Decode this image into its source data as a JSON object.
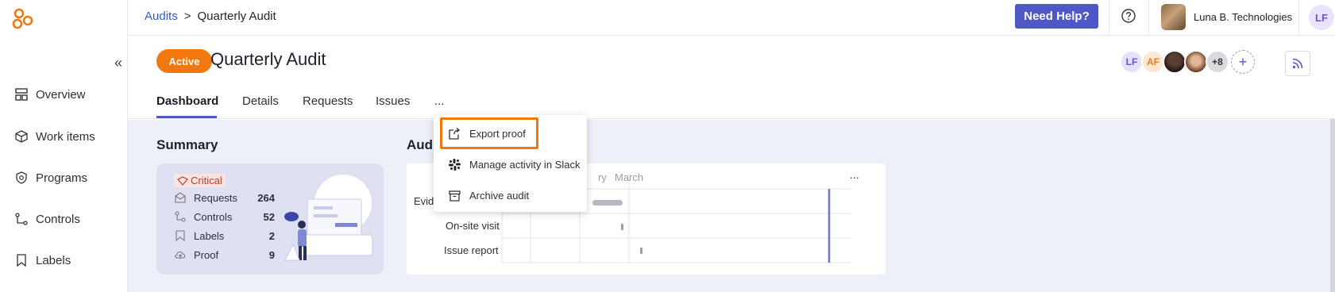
{
  "breadcrumb": {
    "parent": "Audits",
    "separator": ">",
    "current": "Quarterly Audit"
  },
  "topbar": {
    "help_label": "Need Help?",
    "org_name": "Luna B. Technologies",
    "user_initials": "LF"
  },
  "sidebar": {
    "items": [
      {
        "label": "Overview",
        "icon": "overview-icon"
      },
      {
        "label": "Work items",
        "icon": "cube-icon"
      },
      {
        "label": "Programs",
        "icon": "shield-icon"
      },
      {
        "label": "Controls",
        "icon": "controls-icon"
      },
      {
        "label": "Labels",
        "icon": "tag-icon"
      }
    ]
  },
  "audit": {
    "status": "Active",
    "title": "Quarterly Audit"
  },
  "tabs": [
    {
      "label": "Dashboard",
      "active": true
    },
    {
      "label": "Details"
    },
    {
      "label": "Requests"
    },
    {
      "label": "Issues"
    },
    {
      "label": "..."
    }
  ],
  "team": [
    {
      "initials": "LF",
      "bg": "#e7e0fb",
      "color": "#6f52d8"
    },
    {
      "initials": "AF",
      "bg": "#fde7d2",
      "color": "#e67e22"
    },
    {
      "initials": "",
      "bg": "#3a2b25",
      "color": "#fff"
    },
    {
      "initials": "",
      "bg": "#b07a5a",
      "color": "#fff"
    },
    {
      "initials": "+8",
      "bg": "#d9dadf",
      "color": "#333"
    }
  ],
  "summary": {
    "title": "Summary",
    "critical_label": "Critical",
    "rows": [
      {
        "label": "Requests",
        "value": "264"
      },
      {
        "label": "Controls",
        "value": "52"
      },
      {
        "label": "Labels",
        "value": "2"
      },
      {
        "label": "Proof",
        "value": "9"
      }
    ]
  },
  "timeline": {
    "title_partial": "Audi",
    "month_partial": "ry",
    "month": "March",
    "more": "...",
    "rows": [
      "Evide",
      "On-site visit",
      "Issue report"
    ]
  },
  "menu": {
    "items": [
      {
        "label": "Export proof",
        "icon": "export-icon"
      },
      {
        "label": "Manage activity in Slack",
        "icon": "slack-icon"
      },
      {
        "label": "Archive audit",
        "icon": "archive-icon"
      }
    ]
  },
  "colors": {
    "accent": "#4e58c6",
    "status": "#f0780e",
    "critical": "#c0392b"
  }
}
